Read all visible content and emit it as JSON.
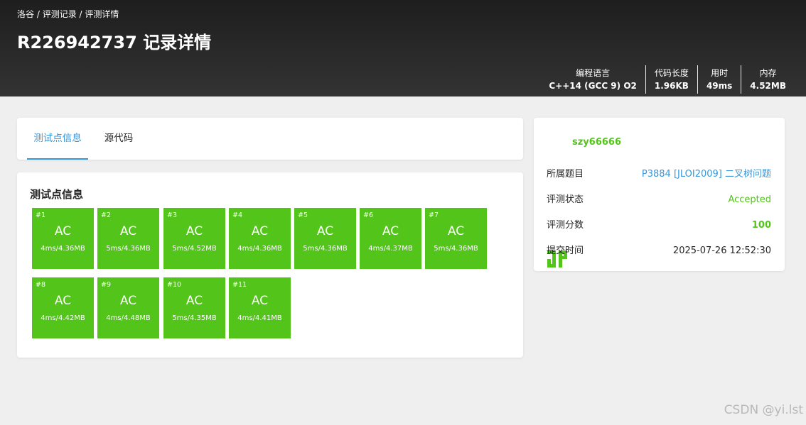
{
  "header": {
    "breadcrumb": [
      "洛谷",
      "评测记录",
      "评测详情"
    ],
    "breadcrumb_sep": " / ",
    "title": "R226942737 记录详情",
    "stats": [
      {
        "label": "编程语言",
        "value": "C++14 (GCC 9) O2"
      },
      {
        "label": "代码长度",
        "value": "1.96KB"
      },
      {
        "label": "用时",
        "value": "49ms"
      },
      {
        "label": "内存",
        "value": "4.52MB"
      }
    ]
  },
  "tabs": [
    {
      "label": "测试点信息",
      "active": true
    },
    {
      "label": "源代码",
      "active": false
    }
  ],
  "tests": {
    "title": "测试点信息",
    "color": "#52c41a",
    "cases": [
      {
        "id": "#1",
        "status": "AC",
        "meta": "4ms/4.36MB"
      },
      {
        "id": "#2",
        "status": "AC",
        "meta": "5ms/4.36MB"
      },
      {
        "id": "#3",
        "status": "AC",
        "meta": "5ms/4.52MB"
      },
      {
        "id": "#4",
        "status": "AC",
        "meta": "4ms/4.36MB"
      },
      {
        "id": "#5",
        "status": "AC",
        "meta": "5ms/4.36MB"
      },
      {
        "id": "#6",
        "status": "AC",
        "meta": "4ms/4.37MB"
      },
      {
        "id": "#7",
        "status": "AC",
        "meta": "5ms/4.36MB"
      },
      {
        "id": "#8",
        "status": "AC",
        "meta": "4ms/4.42MB"
      },
      {
        "id": "#9",
        "status": "AC",
        "meta": "4ms/4.48MB"
      },
      {
        "id": "#10",
        "status": "AC",
        "meta": "5ms/4.35MB"
      },
      {
        "id": "#11",
        "status": "AC",
        "meta": "4ms/4.41MB"
      }
    ]
  },
  "user": {
    "name": "szy66666",
    "avatar_icon": "user-avatar-icon",
    "name_color": "#52c41a"
  },
  "info": {
    "problem_label": "所属题目",
    "problem_value": "P3884 [JLOI2009] 二叉树问题",
    "status_label": "评测状态",
    "status_value": "Accepted",
    "score_label": "评测分数",
    "score_value": "100",
    "time_label": "提交时间",
    "time_value": "2025-07-26 12:52:30"
  },
  "watermark": "CSDN @yi.lst",
  "colors": {
    "accent": "#3498db",
    "success": "#52c41a",
    "header_dark": "#262626"
  }
}
